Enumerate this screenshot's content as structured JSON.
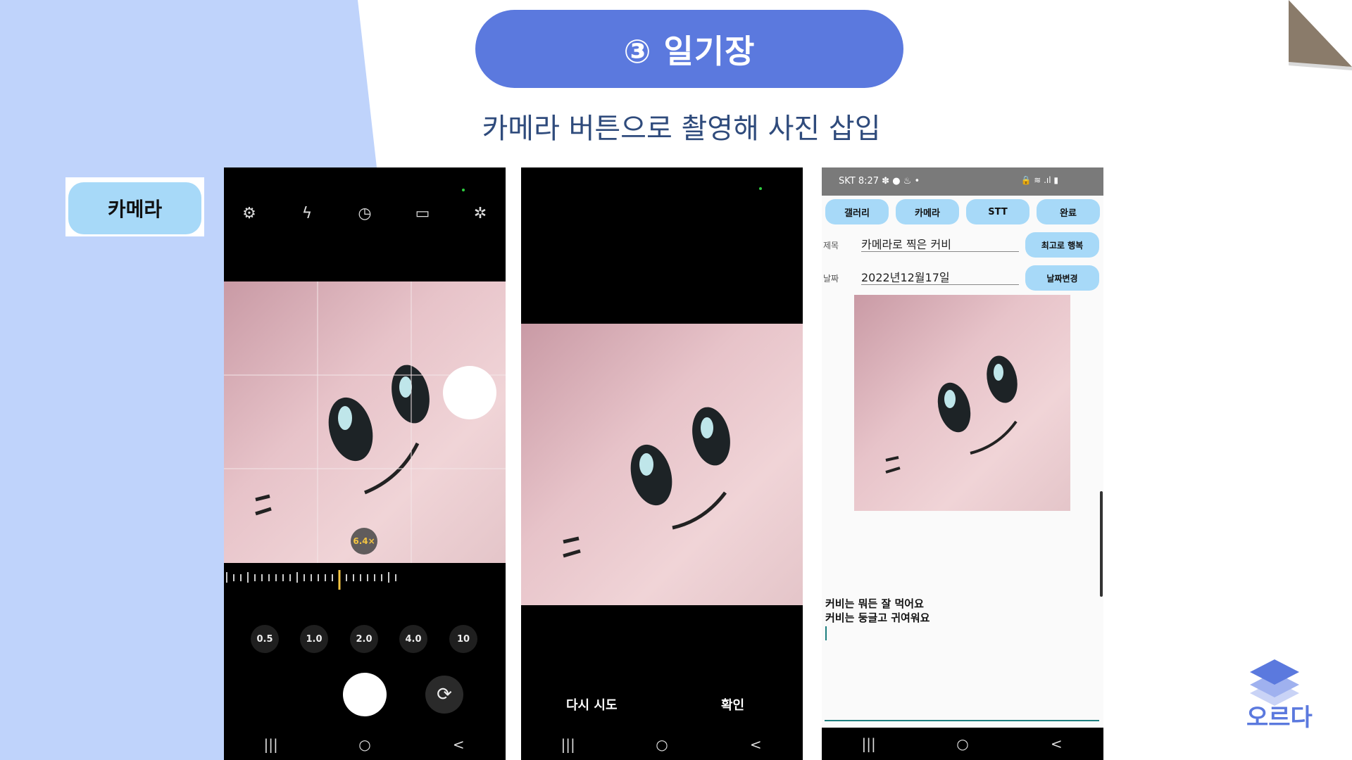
{
  "slide": {
    "title": "③ 일기장",
    "subtitle": "카메라 버튼으로 촬영해 사진 삽입",
    "camera_chip": "카메라",
    "logo_text": "오르다",
    "colors": {
      "accent": "#5b79de",
      "side_panel": "#bfd3fb",
      "chip": "#a7d9f8",
      "corner": "#8a7b6a"
    }
  },
  "camera_screen": {
    "top_icons": [
      "gear-icon",
      "flash-icon",
      "timer-icon",
      "ratio-icon",
      "sparkle-icon"
    ],
    "zoom_badge": "6.4×",
    "zoom_levels": [
      "0.5",
      "1.0",
      "2.0",
      "4.0",
      "10"
    ]
  },
  "preview_screen": {
    "retry_label": "다시 시도",
    "confirm_label": "확인"
  },
  "diary_screen": {
    "status_time": "SKT 8:27 ✽ ● ♨ •",
    "status_right": "🔒 ≋ .ıl ▮",
    "buttons": [
      "갤러리",
      "카메라",
      "STT",
      "완료"
    ],
    "title_label": "제목",
    "title_value": "카메라로 찍은 커비",
    "title_action": "최고로 행복",
    "date_label": "날짜",
    "date_value": "2022년12월17일",
    "date_action": "날짜변경",
    "body_lines": [
      "커비는 뭐든 잘 먹어요",
      "커비는 둥글고 귀여워요"
    ]
  },
  "nav": {
    "recent": "|||",
    "home": "○",
    "back": "<"
  }
}
